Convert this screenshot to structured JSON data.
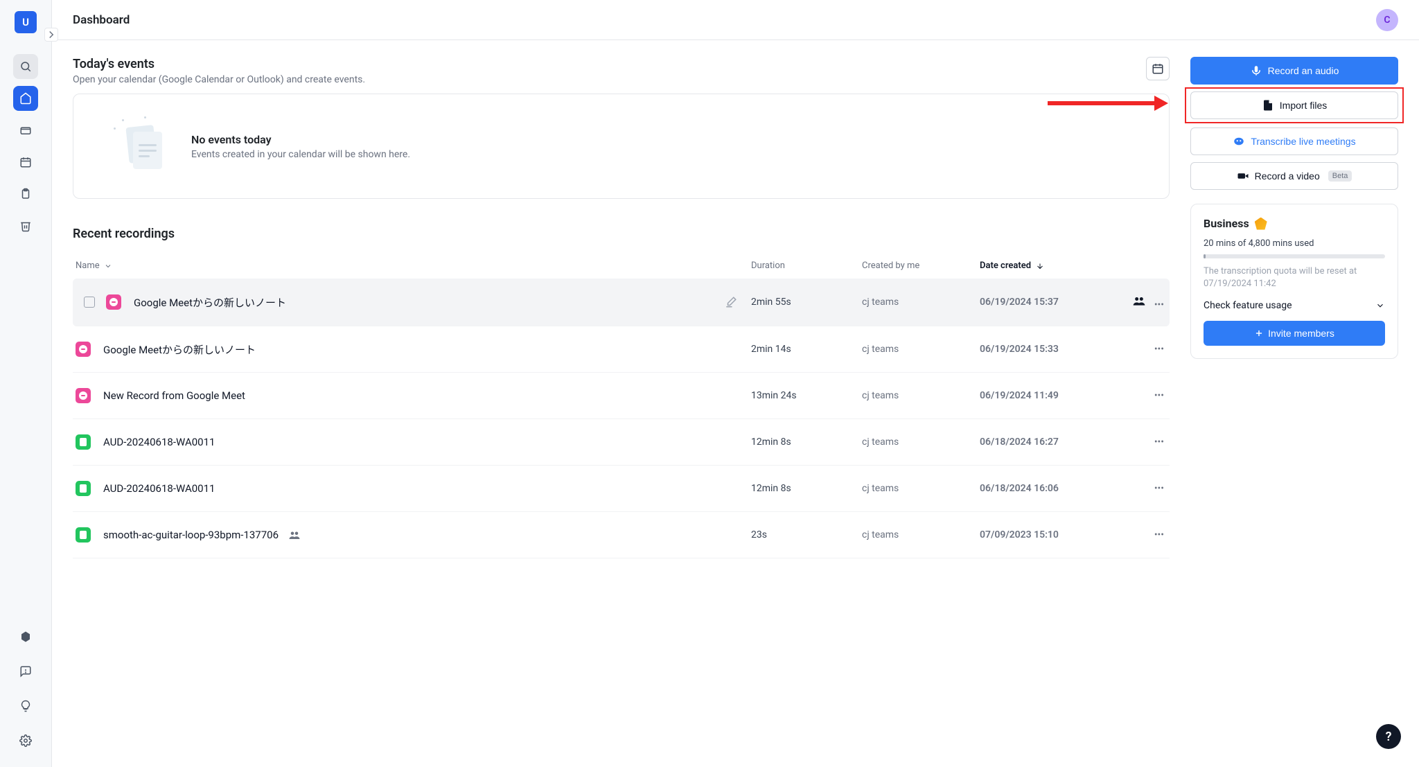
{
  "header": {
    "title": "Dashboard",
    "user_initial": "C"
  },
  "sidebar": {
    "workspace_initial": "U"
  },
  "events": {
    "title": "Today's events",
    "subtitle": "Open your calendar (Google Calendar or Outlook) and create events.",
    "empty_title": "No events today",
    "empty_sub": "Events created in your calendar will be shown here."
  },
  "recordings": {
    "title": "Recent recordings",
    "columns": {
      "name": "Name",
      "duration": "Duration",
      "creator": "Created by me",
      "date": "Date created"
    },
    "rows": [
      {
        "name": "Google Meetからの新しいノート",
        "duration": "2min 55s",
        "creator": "cj teams",
        "date": "06/19/2024 15:37",
        "icon": "red",
        "highlight": true,
        "editable": true,
        "shared": true
      },
      {
        "name": "Google Meetからの新しいノート",
        "duration": "2min 14s",
        "creator": "cj teams",
        "date": "06/19/2024 15:33",
        "icon": "red"
      },
      {
        "name": "New Record from Google Meet",
        "duration": "13min 24s",
        "creator": "cj teams",
        "date": "06/19/2024 11:49",
        "icon": "red"
      },
      {
        "name": "AUD-20240618-WA0011",
        "duration": "12min 8s",
        "creator": "cj teams",
        "date": "06/18/2024 16:27",
        "icon": "green"
      },
      {
        "name": "AUD-20240618-WA0011",
        "duration": "12min 8s",
        "creator": "cj teams",
        "date": "06/18/2024 16:06",
        "icon": "green"
      },
      {
        "name": "smooth-ac-guitar-loop-93bpm-137706",
        "duration": "23s",
        "creator": "cj teams",
        "date": "07/09/2023 15:10",
        "icon": "green",
        "shared_inline": true
      }
    ]
  },
  "actions": {
    "record_audio": "Record an audio",
    "import_files": "Import files",
    "transcribe": "Transcribe live meetings",
    "record_video": "Record a video",
    "beta": "Beta"
  },
  "business": {
    "title": "Business",
    "usage": "20 mins of 4,800 mins used",
    "reset_notice": "The transcription quota will be reset at 07/19/2024 11:42",
    "feature_usage": "Check feature usage",
    "invite": "Invite members"
  }
}
